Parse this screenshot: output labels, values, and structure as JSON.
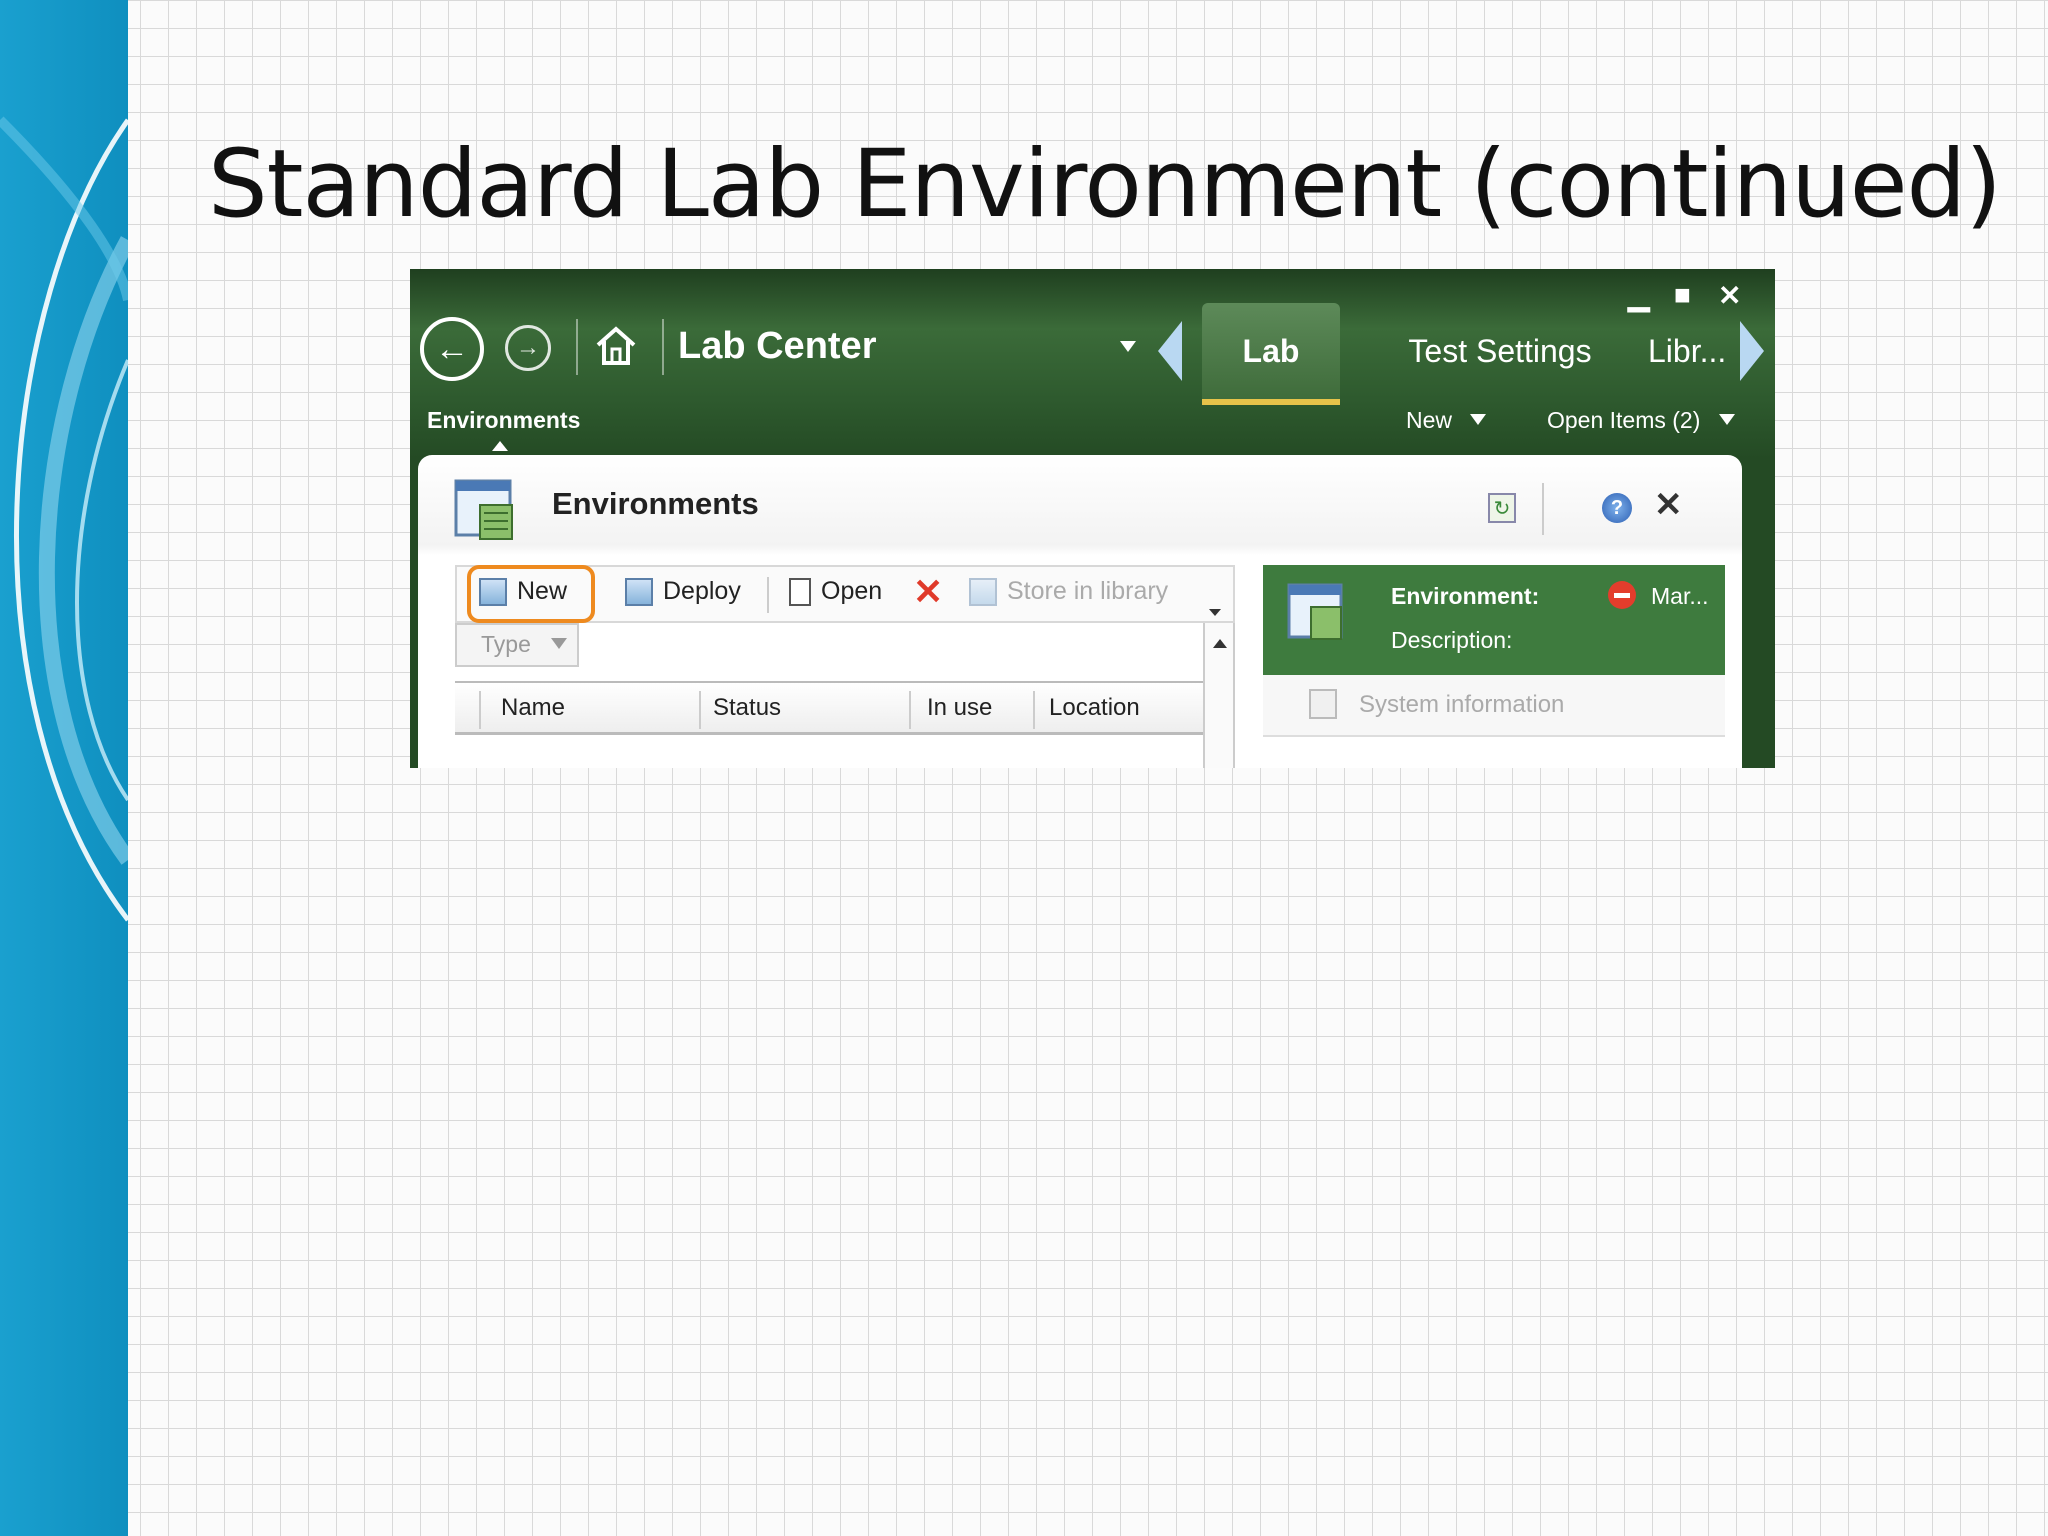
{
  "slide": {
    "title": "Standard Lab Environment (continued)"
  },
  "window": {
    "app_title": "Lab Center",
    "tabs": [
      {
        "label": "Lab",
        "active": true
      },
      {
        "label": "Test Settings",
        "active": false
      },
      {
        "label": "Libr...",
        "active": false
      }
    ],
    "section": "Environments",
    "new_menu": "New",
    "open_items": "Open Items (2)"
  },
  "panel": {
    "title": "Environments",
    "toolbar": {
      "new": "New",
      "deploy": "Deploy",
      "open": "Open",
      "store": "Store in library"
    },
    "type_filter": "Type",
    "columns": [
      "Name",
      "Status",
      "In use",
      "Location"
    ],
    "details": {
      "environment_label": "Environment:",
      "description_label": "Description:",
      "state": "Mar...",
      "system_information": "System information"
    }
  },
  "colors": {
    "header_green": "#2f5a2f",
    "accent_green": "#3e7b3e",
    "highlight_orange": "#ee8a1f",
    "active_tab_underline": "#e6c34a",
    "sidebar_blue": "#1a9ccc"
  },
  "icons": [
    "back-icon",
    "forward-icon",
    "home-icon",
    "minimize-icon",
    "maximize-icon",
    "close-icon",
    "refresh-icon",
    "help-icon",
    "delete-icon",
    "stop-icon"
  ]
}
